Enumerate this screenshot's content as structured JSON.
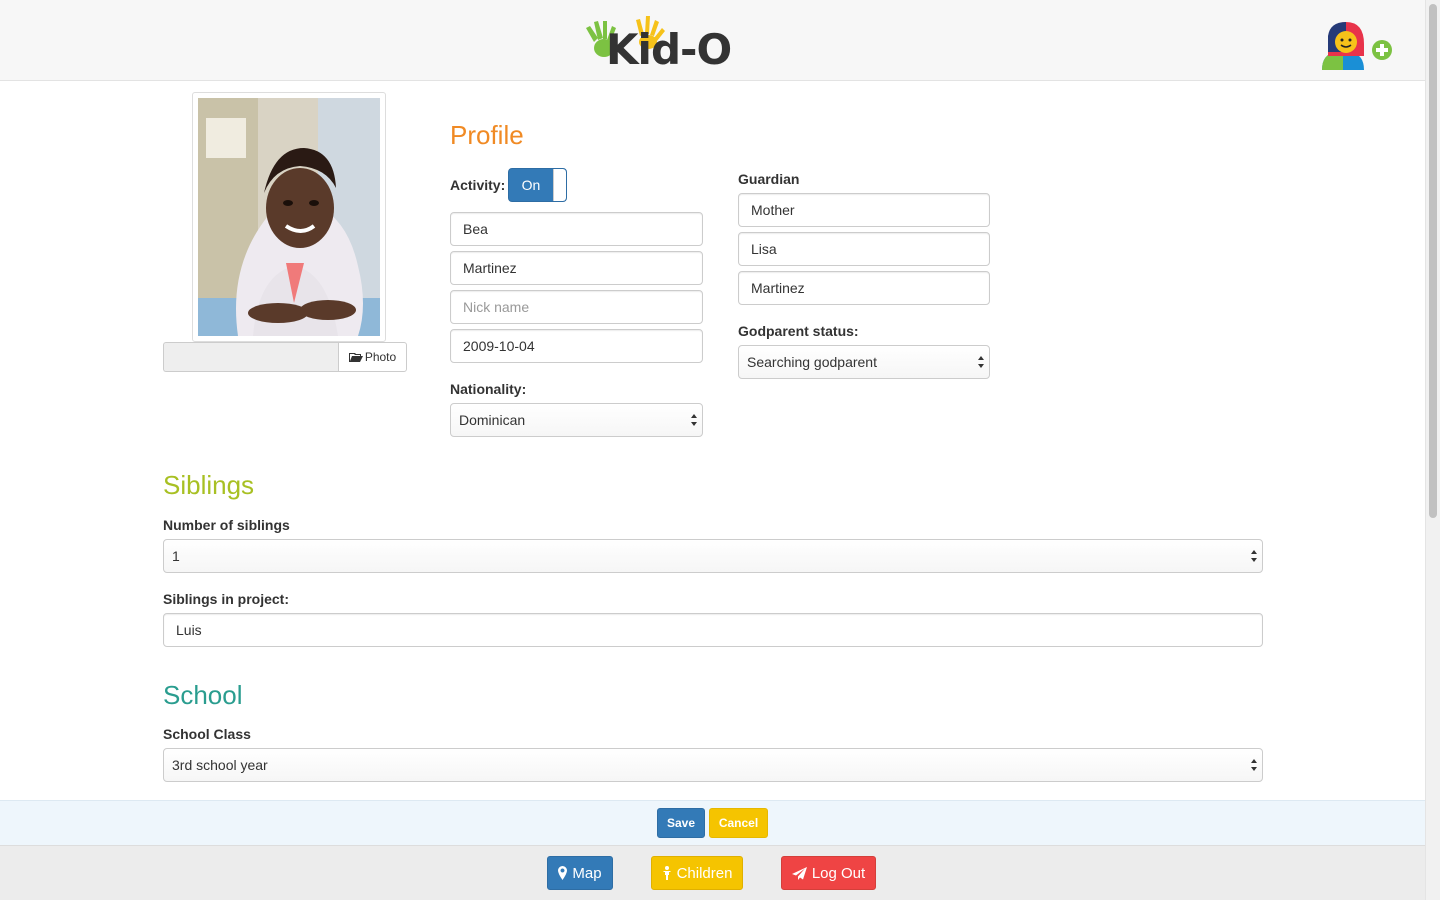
{
  "header": {
    "logo_text": "Kid-O",
    "add_user_icon": "add-user-icon"
  },
  "photo": {
    "upload_label": "Photo",
    "upload_icon": "folder-open-icon"
  },
  "profile": {
    "title": "Profile",
    "activity_label": "Activity:",
    "activity_toggle": "On",
    "first_name": "Bea",
    "last_name": "Martinez",
    "nick_name_placeholder": "Nick name",
    "birth_date": "2009-10-04",
    "nationality_label": "Nationality:",
    "nationality": "Dominican"
  },
  "guardian": {
    "label": "Guardian",
    "relation": "Mother",
    "first_name": "Lisa",
    "last_name": "Martinez",
    "godparent_label": "Godparent status:",
    "godparent_status": "Searching godparent"
  },
  "siblings": {
    "title": "Siblings",
    "number_label": "Number of siblings",
    "number": "1",
    "in_project_label": "Siblings in project:",
    "in_project": "Luis"
  },
  "school": {
    "title": "School",
    "class_label": "School Class",
    "class": "3rd school year"
  },
  "actions": {
    "save": "Save",
    "cancel": "Cancel"
  },
  "nav": {
    "map": "Map",
    "children": "Children",
    "logout": "Log Out"
  },
  "colors": {
    "primary": "#337ab7",
    "warning": "#f5c400",
    "danger": "#ef4444",
    "profile_heading": "#f08a24",
    "siblings_heading": "#a8c023",
    "school_heading": "#2a9d8f"
  }
}
